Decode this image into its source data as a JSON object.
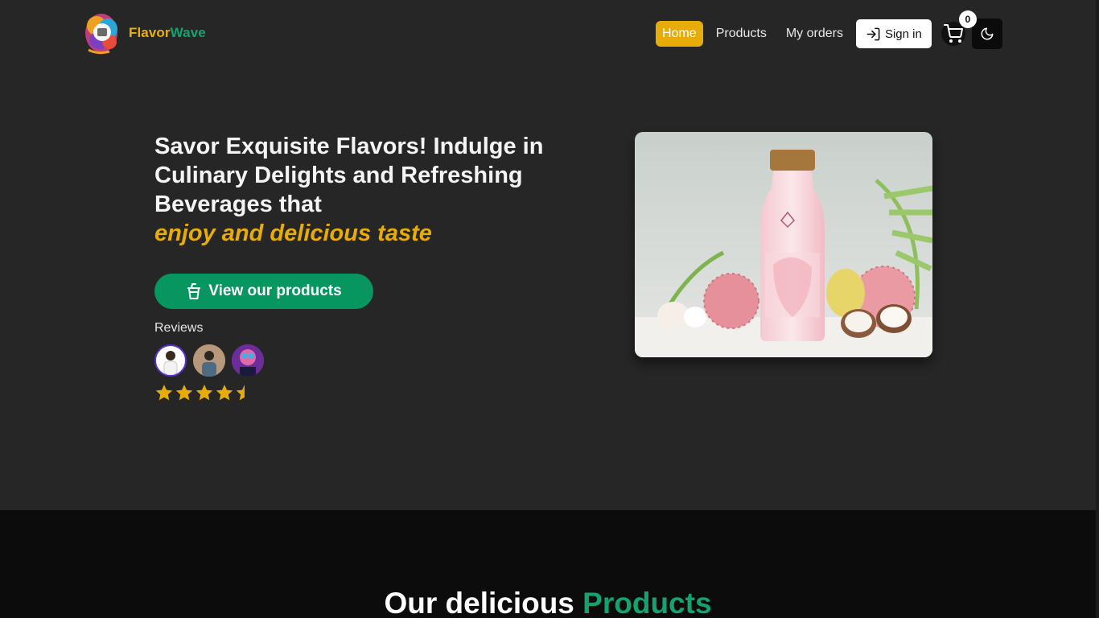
{
  "header": {
    "brand_part1": "Flavor",
    "brand_part2": "Wave",
    "nav": [
      {
        "label": "Home",
        "active": true
      },
      {
        "label": "Products",
        "active": false
      },
      {
        "label": "My orders",
        "active": false
      }
    ],
    "sign_in_label": "Sign in",
    "cart_count": "0",
    "icons": {
      "sign_in": "login-arrow-icon",
      "cart": "shopping-cart-icon",
      "theme": "moon-icon"
    }
  },
  "hero": {
    "title": "Savor Exquisite Flavors! Indulge in Culinary Delights and Refreshing Beverages that",
    "accent": "enjoy and delicious taste",
    "cta_label": "View our products",
    "cta_icon": "cup-icon",
    "reviews_label": "Reviews",
    "rating": 4.5,
    "rating_max": 5
  },
  "products": {
    "title_part1": "Our delicious",
    "title_part2": "Products"
  },
  "colors": {
    "accent_yellow": "#e7ac07",
    "brand_green": "#079660",
    "background": "#262626",
    "section_dark": "#0c0c0c"
  }
}
